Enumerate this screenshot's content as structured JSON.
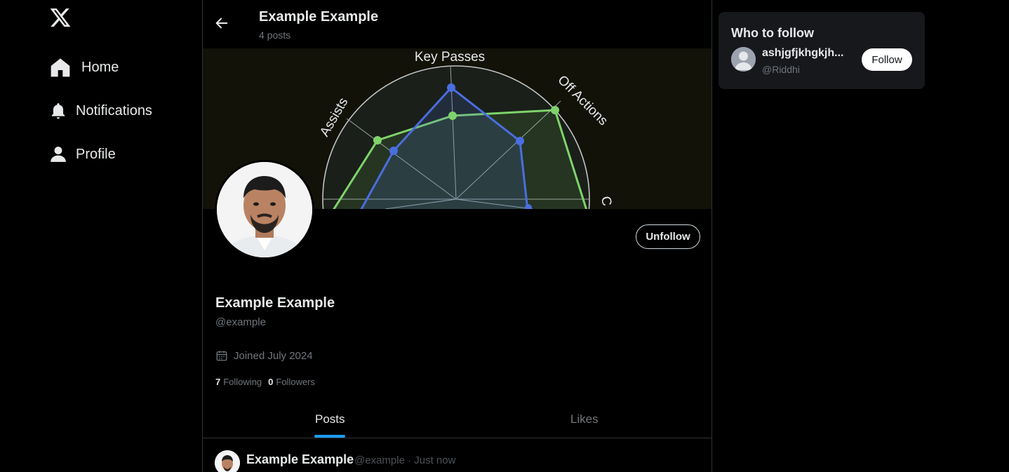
{
  "nav": {
    "logo": "x-logo-icon",
    "items": [
      {
        "label": "Home",
        "icon": "home-icon"
      },
      {
        "label": "Notifications",
        "icon": "bell-icon"
      },
      {
        "label": "Profile",
        "icon": "person-icon"
      }
    ]
  },
  "header": {
    "title": "Example Example",
    "subtitle": "4 posts"
  },
  "banner": {
    "radar_labels": [
      "Key Passes",
      "Off Actions",
      "Assists",
      "C"
    ],
    "colors": {
      "series_blue": "#4a6ee0",
      "series_green": "#7fd36a",
      "background": "#121209"
    }
  },
  "profile": {
    "name": "Example Example",
    "handle": "@example",
    "joined": "Joined July 2024",
    "following_count": "7",
    "following_label": "Following",
    "followers_count": "0",
    "followers_label": "Followers",
    "unfollow_label": "Unfollow"
  },
  "tabs": [
    {
      "label": "Posts",
      "active": true
    },
    {
      "label": "Likes",
      "active": false
    }
  ],
  "post": {
    "author": "Example Example",
    "meta": "@example · Just now"
  },
  "who_to_follow": {
    "title": "Who to follow",
    "user_name": "ashjgfjkhgkjh...",
    "user_handle": "@Riddhi",
    "follow_label": "Follow"
  },
  "colors": {
    "accent": "#1d9bf0",
    "muted": "#71767b",
    "border": "#2f3336",
    "card": "#16181c"
  }
}
